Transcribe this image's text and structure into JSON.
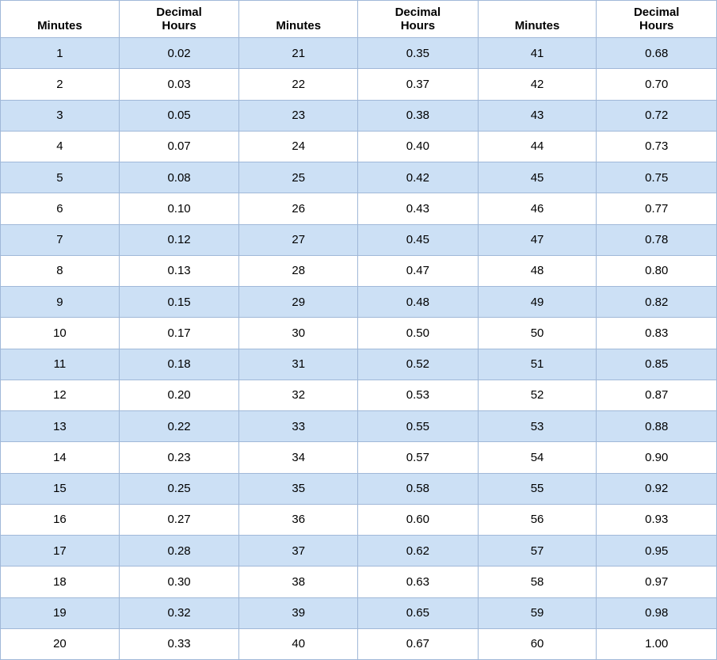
{
  "table": {
    "columns": [
      {
        "header_line1": "Minutes",
        "header_line2": ""
      },
      {
        "header_line1": "Decimal",
        "header_line2": "Hours"
      },
      {
        "header_line1": "Minutes",
        "header_line2": ""
      },
      {
        "header_line1": "Decimal",
        "header_line2": "Hours"
      },
      {
        "header_line1": "Minutes",
        "header_line2": ""
      },
      {
        "header_line1": "Decimal",
        "header_line2": "Hours"
      }
    ],
    "rows": [
      [
        1,
        "0.02",
        21,
        "0.35",
        41,
        "0.68"
      ],
      [
        2,
        "0.03",
        22,
        "0.37",
        42,
        "0.70"
      ],
      [
        3,
        "0.05",
        23,
        "0.38",
        43,
        "0.72"
      ],
      [
        4,
        "0.07",
        24,
        "0.40",
        44,
        "0.73"
      ],
      [
        5,
        "0.08",
        25,
        "0.42",
        45,
        "0.75"
      ],
      [
        6,
        "0.10",
        26,
        "0.43",
        46,
        "0.77"
      ],
      [
        7,
        "0.12",
        27,
        "0.45",
        47,
        "0.78"
      ],
      [
        8,
        "0.13",
        28,
        "0.47",
        48,
        "0.80"
      ],
      [
        9,
        "0.15",
        29,
        "0.48",
        49,
        "0.82"
      ],
      [
        10,
        "0.17",
        30,
        "0.50",
        50,
        "0.83"
      ],
      [
        11,
        "0.18",
        31,
        "0.52",
        51,
        "0.85"
      ],
      [
        12,
        "0.20",
        32,
        "0.53",
        52,
        "0.87"
      ],
      [
        13,
        "0.22",
        33,
        "0.55",
        53,
        "0.88"
      ],
      [
        14,
        "0.23",
        34,
        "0.57",
        54,
        "0.90"
      ],
      [
        15,
        "0.25",
        35,
        "0.58",
        55,
        "0.92"
      ],
      [
        16,
        "0.27",
        36,
        "0.60",
        56,
        "0.93"
      ],
      [
        17,
        "0.28",
        37,
        "0.62",
        57,
        "0.95"
      ],
      [
        18,
        "0.30",
        38,
        "0.63",
        58,
        "0.97"
      ],
      [
        19,
        "0.32",
        39,
        "0.65",
        59,
        "0.98"
      ],
      [
        20,
        "0.33",
        40,
        "0.67",
        60,
        "1.00"
      ]
    ]
  }
}
